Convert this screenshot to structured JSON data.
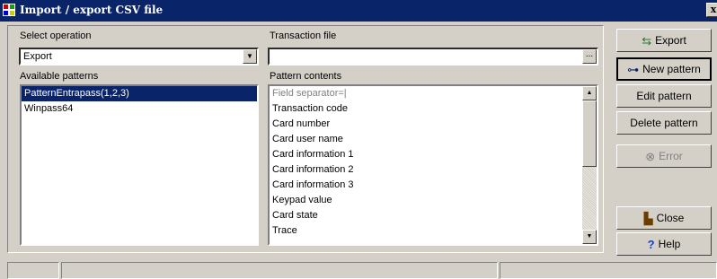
{
  "window": {
    "title": "Import / export CSV file",
    "close_glyph": "x"
  },
  "operation": {
    "label": "Select operation",
    "value": "Export"
  },
  "transaction": {
    "label": "Transaction file",
    "value": "",
    "browse_label": "..."
  },
  "patterns": {
    "label": "Available patterns",
    "items": [
      "PatternEntrapass(1,2,3)",
      "Winpass64"
    ],
    "selected_index": 0
  },
  "contents": {
    "label": "Pattern contents",
    "items": [
      "Field separator=|",
      "Transaction code",
      "Card number",
      "Card user name",
      "Card information 1",
      "Card information 2",
      "Card information 3",
      "Keypad value",
      "Card state",
      "Trace"
    ]
  },
  "buttons": {
    "export": "Export",
    "new_pattern": "New pattern",
    "edit_pattern": "Edit pattern",
    "delete_pattern": "Delete pattern",
    "error": "Error",
    "close": "Close",
    "help": "Help"
  },
  "icons": {
    "export": "export-icon",
    "new_pattern": "new-pattern-icon",
    "error": "error-icon",
    "close": "close-door-icon",
    "help": "help-icon"
  },
  "colors": {
    "titlebar": "#0a246a",
    "selection": "#0a246a",
    "face": "#d4d0c8"
  }
}
